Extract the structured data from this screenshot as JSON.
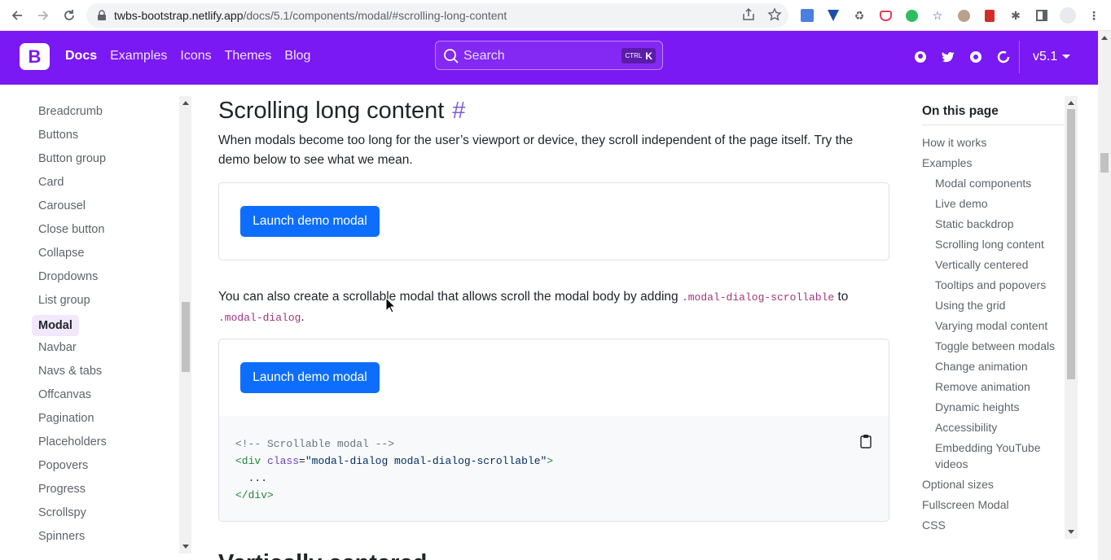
{
  "browser": {
    "url_host": "twbs-bootstrap.netlify.app",
    "url_path": "/docs/5.1/components/modal/#scrolling-long-content"
  },
  "navbar": {
    "logo": "B",
    "links": [
      {
        "label": "Docs",
        "active": true
      },
      {
        "label": "Examples",
        "active": false
      },
      {
        "label": "Icons",
        "active": false
      },
      {
        "label": "Themes",
        "active": false
      },
      {
        "label": "Blog",
        "active": false
      }
    ],
    "search_placeholder": "Search",
    "search_kbd_ctrl": "CTRL",
    "search_kbd_key": "K",
    "version": "v5.1",
    "icons": [
      "github-icon",
      "twitter-icon",
      "opencollective-icon",
      "loading-icon"
    ]
  },
  "sidebar": {
    "items": [
      "Breadcrumb",
      "Buttons",
      "Button group",
      "Card",
      "Carousel",
      "Close button",
      "Collapse",
      "Dropdowns",
      "List group",
      "Modal",
      "Navbar",
      "Navs & tabs",
      "Offcanvas",
      "Pagination",
      "Placeholders",
      "Popovers",
      "Progress",
      "Scrollspy",
      "Spinners"
    ],
    "active": "Modal"
  },
  "main": {
    "heading": "Scrolling long content",
    "heading_anchor": "#",
    "para1": "When modals become too long for the user’s viewport or device, they scroll independent of the page itself. Try the demo below to see what we mean.",
    "button1": "Launch demo modal",
    "para2_a": "You can also create a scrollable modal that allows scroll the modal body by adding ",
    "para2_code1": ".modal-dialog-scrollable",
    "para2_b": " to ",
    "para2_code2": ".modal-dialog",
    "para2_c": ".",
    "button2": "Launch demo modal",
    "code_line1": "<!-- Scrollable modal -->",
    "code_line2_open": "<div",
    "code_line2_attr": " class",
    "code_line2_eq": "=",
    "code_line2_val": "\"modal-dialog modal-dialog-scrollable\"",
    "code_line2_close": ">",
    "code_line3": "  ...",
    "code_line4": "</div>",
    "next_heading": "Vertically centered"
  },
  "toc": {
    "title": "On this page",
    "items": [
      {
        "label": "How it works",
        "sub": false
      },
      {
        "label": "Examples",
        "sub": false
      },
      {
        "label": "Modal components",
        "sub": true
      },
      {
        "label": "Live demo",
        "sub": true
      },
      {
        "label": "Static backdrop",
        "sub": true
      },
      {
        "label": "Scrolling long content",
        "sub": true
      },
      {
        "label": "Vertically centered",
        "sub": true
      },
      {
        "label": "Tooltips and popovers",
        "sub": true
      },
      {
        "label": "Using the grid",
        "sub": true
      },
      {
        "label": "Varying modal content",
        "sub": true
      },
      {
        "label": "Toggle between modals",
        "sub": true
      },
      {
        "label": "Change animation",
        "sub": true
      },
      {
        "label": "Remove animation",
        "sub": true
      },
      {
        "label": "Dynamic heights",
        "sub": true
      },
      {
        "label": "Accessibility",
        "sub": true
      },
      {
        "label": "Embedding YouTube videos",
        "sub": true
      },
      {
        "label": "Optional sizes",
        "sub": false
      },
      {
        "label": "Fullscreen Modal",
        "sub": false
      },
      {
        "label": "CSS",
        "sub": false
      }
    ]
  },
  "colors": {
    "brand": "#7a19f3",
    "primary": "#0d6efd",
    "active_bg": "#f1e8fd"
  }
}
